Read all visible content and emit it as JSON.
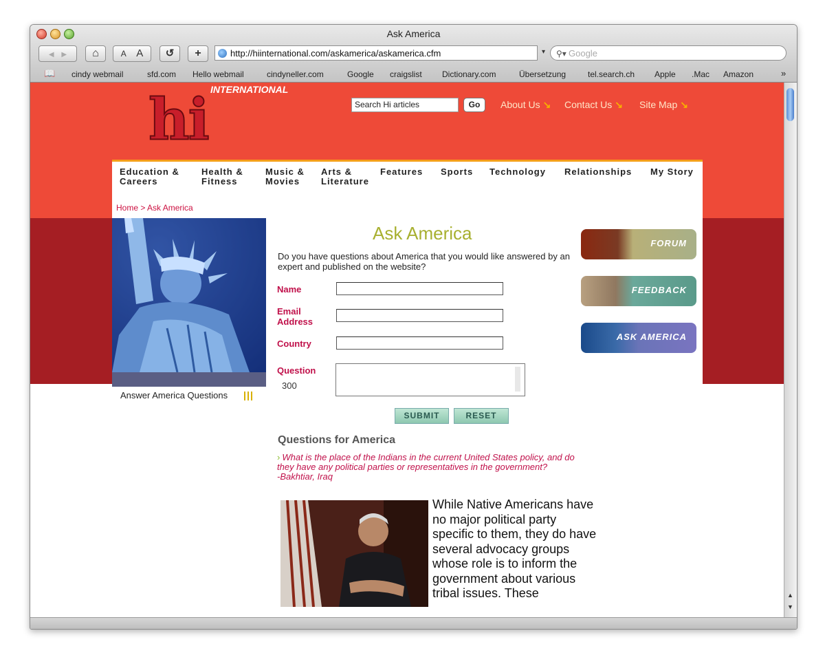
{
  "window": {
    "title": "Ask America"
  },
  "toolbar": {
    "text_smaller": "A",
    "text_larger": "A",
    "reload": "↺",
    "add": "+",
    "back": "◀",
    "forward": "▶",
    "home": "⌂"
  },
  "address": {
    "url": "http://hiinternational.com/askamerica/askamerica.cfm"
  },
  "search": {
    "placeholder": "Google"
  },
  "bookmarks": [
    "cindy webmail",
    "sfd.com",
    "Hello webmail",
    "cindyneller.com",
    "Google",
    "craigslist",
    "Dictionary.com",
    "Übersetzung",
    "tel.search.ch",
    "Apple",
    ".Mac",
    "Amazon"
  ],
  "site": {
    "logo": "hi",
    "logo_sub": "INTERNATIONAL",
    "search_value": "Search Hi articles",
    "go": "Go",
    "header_links": [
      "About Us",
      "Contact Us",
      "Site Map"
    ],
    "nav": [
      [
        "Education &",
        "Careers"
      ],
      [
        "Health &",
        "Fitness"
      ],
      [
        "Music &",
        "Movies"
      ],
      [
        "Arts &",
        "Literature"
      ],
      [
        "Features",
        ""
      ],
      [
        "Sports",
        ""
      ],
      [
        "Technology",
        ""
      ],
      [
        "Relationships",
        ""
      ],
      [
        "My Story",
        ""
      ]
    ],
    "breadcrumb": "Home > Ask America"
  },
  "main": {
    "title": "Ask America",
    "intro": "Do you have questions about America that you would like answered by an expert and published on the website?",
    "labels": {
      "name": "Name",
      "email1": "Email",
      "email2": "Address",
      "country": "Country",
      "question": "Question"
    },
    "char_count": "300",
    "submit": "SUBMIT",
    "reset": "RESET",
    "questions_heading": "Questions for America",
    "question_text": "What is the place of the Indians in the current United States policy, and do they have any political parties or representatives in the government?",
    "question_author": "-Bakhtiar, Iraq",
    "answer_text": "While Native Americans have no major political party specific to them, they do have several advocacy groups whose role is to inform the government about various tribal issues. These"
  },
  "left": {
    "answer_link": "Answer America Questions"
  },
  "sidebar": {
    "buttons": [
      "FORUM",
      "FEEDBACK",
      "ASK AMERICA"
    ]
  },
  "colors": {
    "header_bg": "#ee4a38",
    "band_bg": "#a51e23",
    "accent": "#c0104a",
    "title": "#a8b030"
  }
}
